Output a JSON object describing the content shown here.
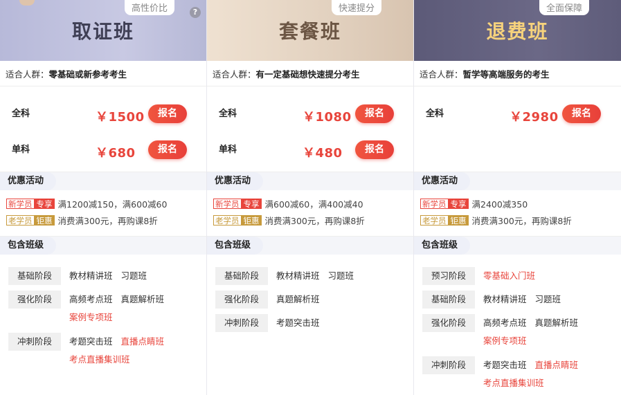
{
  "columns": [
    {
      "title": "取证班",
      "tag": "高性价比",
      "audience_label": "适合人群：",
      "audience_value": "零基础或新参考考生",
      "prices": [
        {
          "name": "全科",
          "amount": "￥1500",
          "btn": "报名"
        },
        {
          "name": "单科",
          "amount": "￥680",
          "btn": "报名"
        }
      ],
      "promo_title": "优惠活动",
      "promos": [
        {
          "badge_a": "新学员",
          "badge_b": "专享",
          "style": "red",
          "text": "满1200减150，满600减60"
        },
        {
          "badge_a": "老学员",
          "badge_b": "钜惠",
          "style": "gold",
          "text": "消费满300元，再购课8折"
        }
      ],
      "classes_title": "包含班级",
      "stages": [
        {
          "label": "基础阶段",
          "items": [
            {
              "t": "教材精讲班",
              "hot": false
            },
            {
              "t": "习题班",
              "hot": false
            }
          ]
        },
        {
          "label": "强化阶段",
          "items": [
            {
              "t": "高频考点班",
              "hot": false
            },
            {
              "t": "真题解析班",
              "hot": false
            },
            {
              "t": "案例专项班",
              "hot": true
            }
          ]
        },
        {
          "label": "冲刺阶段",
          "items": [
            {
              "t": "考题突击班",
              "hot": false
            },
            {
              "t": "直播点睛班",
              "hot": true
            },
            {
              "t": "考点直播集训班",
              "hot": true
            }
          ]
        }
      ]
    },
    {
      "title": "套餐班",
      "tag": "快速提分",
      "audience_label": "适合人群：",
      "audience_value": "有一定基础想快速提分考生",
      "prices": [
        {
          "name": "全科",
          "amount": "￥1080",
          "btn": "报名"
        },
        {
          "name": "单科",
          "amount": "￥480",
          "btn": "报名"
        }
      ],
      "promo_title": "优惠活动",
      "promos": [
        {
          "badge_a": "新学员",
          "badge_b": "专享",
          "style": "red",
          "text": "满600减60，满400减40"
        },
        {
          "badge_a": "老学员",
          "badge_b": "钜惠",
          "style": "gold",
          "text": "消费满300元，再购课8折"
        }
      ],
      "classes_title": "包含班级",
      "stages": [
        {
          "label": "基础阶段",
          "items": [
            {
              "t": "教材精讲班",
              "hot": false
            },
            {
              "t": "习题班",
              "hot": false
            }
          ]
        },
        {
          "label": "强化阶段",
          "items": [
            {
              "t": "真题解析班",
              "hot": false
            }
          ]
        },
        {
          "label": "冲刺阶段",
          "items": [
            {
              "t": "考题突击班",
              "hot": false
            }
          ]
        }
      ]
    },
    {
      "title": "退费班",
      "tag": "全面保障",
      "audience_label": "适合人群：",
      "audience_value": "暂学等高端服务的考生",
      "prices": [
        {
          "name": "全科",
          "amount": "￥2980",
          "btn": "报名"
        }
      ],
      "promo_title": "优惠活动",
      "promos": [
        {
          "badge_a": "新学员",
          "badge_b": "专享",
          "style": "red",
          "text": "满2400减350"
        },
        {
          "badge_a": "老学员",
          "badge_b": "钜惠",
          "style": "gold",
          "text": "消费满300元，再购课8折"
        }
      ],
      "classes_title": "包含班级",
      "stages": [
        {
          "label": "预习阶段",
          "items": [
            {
              "t": "零基础入门班",
              "hot": true
            }
          ]
        },
        {
          "label": "基础阶段",
          "items": [
            {
              "t": "教材精讲班",
              "hot": false
            },
            {
              "t": "习题班",
              "hot": false
            }
          ]
        },
        {
          "label": "强化阶段",
          "items": [
            {
              "t": "高频考点班",
              "hot": false
            },
            {
              "t": "真题解析班",
              "hot": false
            },
            {
              "t": "案例专项班",
              "hot": true
            }
          ]
        },
        {
          "label": "冲刺阶段",
          "items": [
            {
              "t": "考题突击班",
              "hot": false
            },
            {
              "t": "直播点睛班",
              "hot": true
            },
            {
              "t": "考点直播集训班",
              "hot": true
            }
          ]
        }
      ]
    }
  ],
  "help_icon": "question-icon",
  "colors": {
    "accent": "#e8453c",
    "gold": "#c79a3c"
  }
}
